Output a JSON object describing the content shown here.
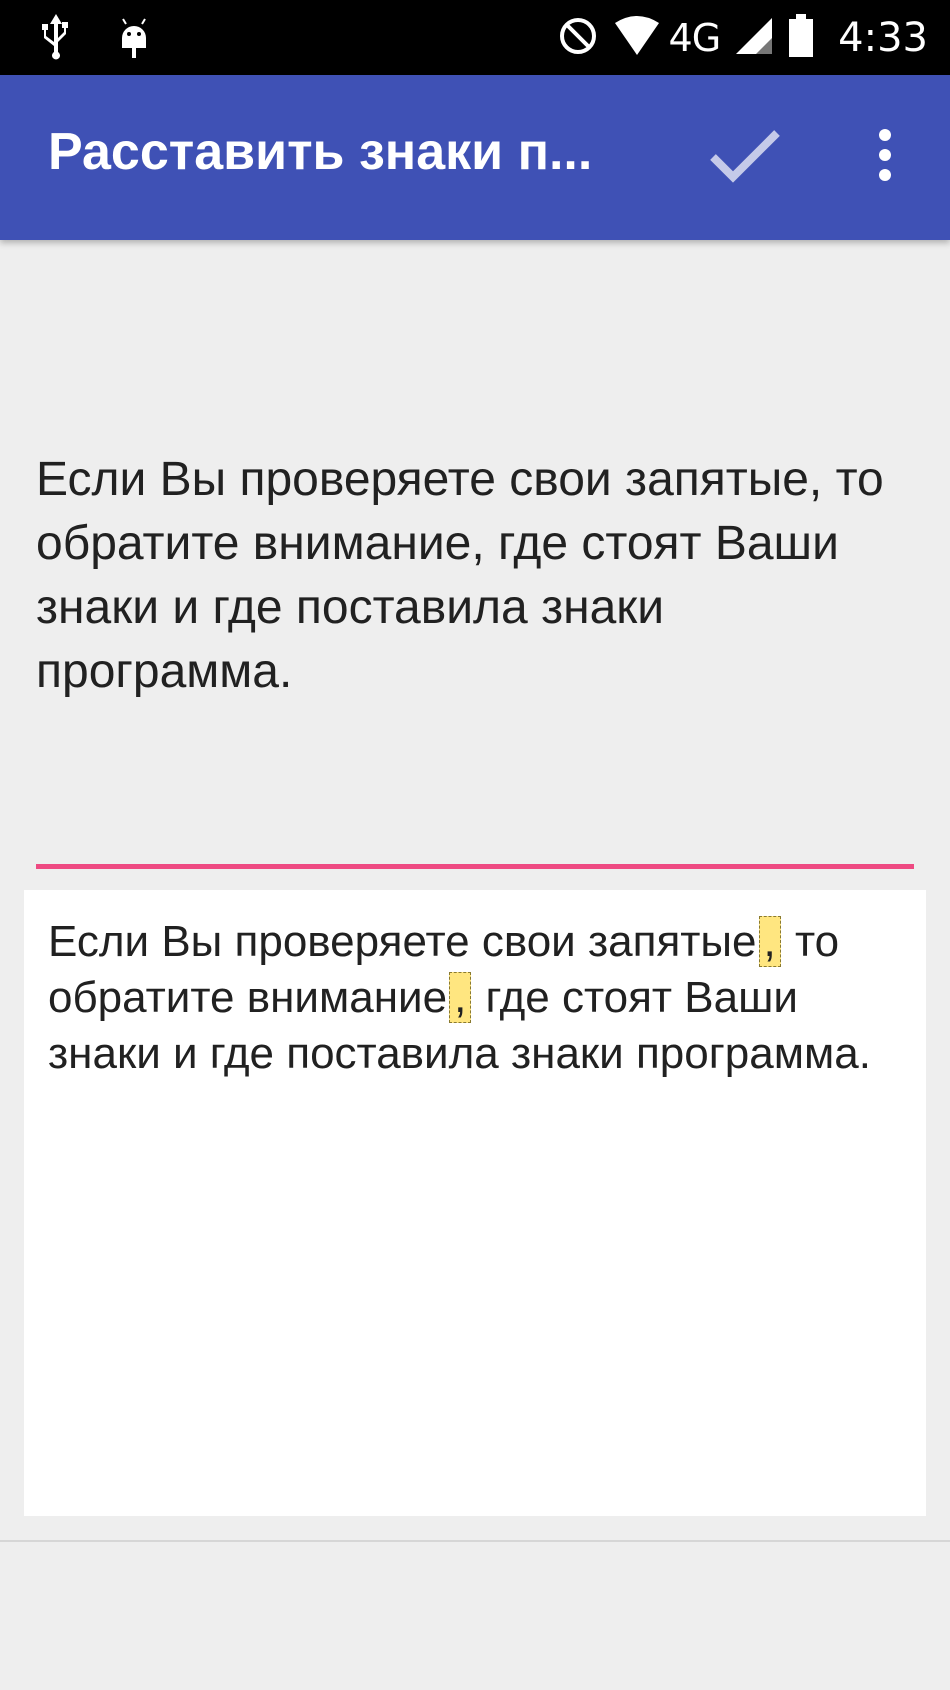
{
  "status_bar": {
    "network": "4G",
    "time": "4:33",
    "icons": [
      "usb-icon",
      "android-debug-icon",
      "do-not-disturb-icon",
      "wifi-icon",
      "signal-icon",
      "battery-icon"
    ]
  },
  "app_bar": {
    "title": "Расставить знаки п...",
    "confirm_icon": "check-icon",
    "menu_icon": "more-vert-icon",
    "color": "#3f51b5"
  },
  "instruction": {
    "text": "Если Вы проверяете свои запятые, то обратите внимание, где стоят Ваши знаки и где поставила знаки программа."
  },
  "result": {
    "part1": "Если Вы проверяете свои запятые",
    "comma1": ",",
    "part2": " то обратите внимание",
    "comma2": ",",
    "part3": " где стоят Ваши знаки и где поставила знаки программа.",
    "highlight_color": "#ffe680"
  },
  "accent_color": "#ee4a82"
}
